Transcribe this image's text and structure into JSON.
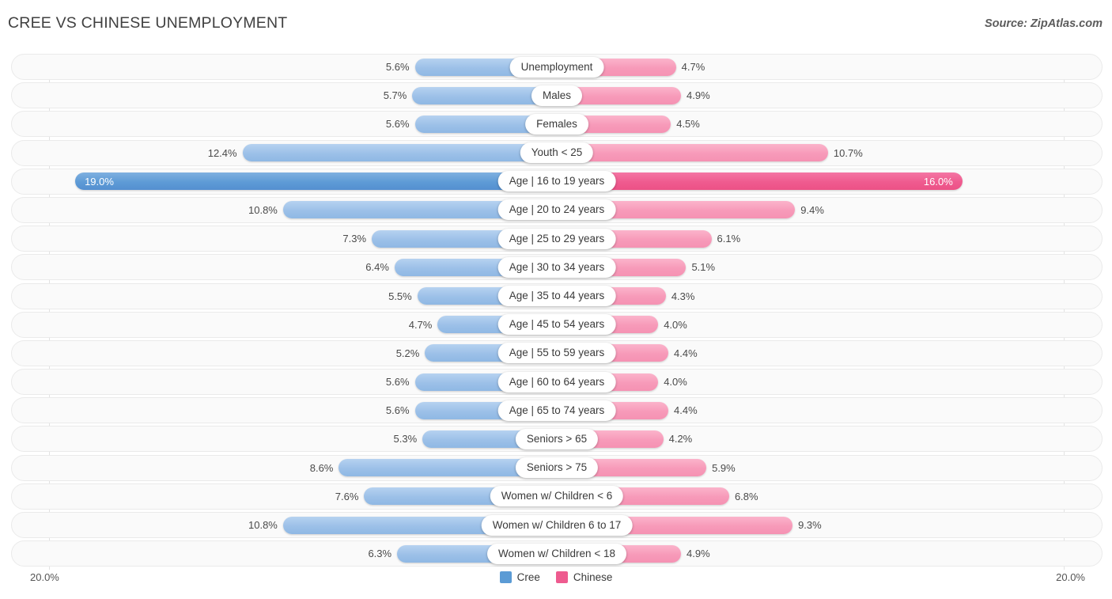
{
  "header": {
    "title": "CREE VS CHINESE UNEMPLOYMENT",
    "source": "Source: ZipAtlas.com"
  },
  "axis": {
    "left_max_label": "20.0%",
    "right_max_label": "20.0%",
    "max_value": 20.0
  },
  "legend": {
    "items": [
      {
        "label": "Cree",
        "color": "#5b9bd5",
        "icon": "square-swatch"
      },
      {
        "label": "Chinese",
        "color": "#ee5b8f",
        "icon": "square-swatch"
      }
    ]
  },
  "chart_data": {
    "type": "bar",
    "subtype": "diverging-butterfly",
    "title": "CREE VS CHINESE UNEMPLOYMENT",
    "xlabel": "",
    "ylabel": "",
    "xlim": [
      0,
      20
    ],
    "grid": false,
    "legend_position": "bottom-center",
    "units": "percent",
    "categories": [
      "Unemployment",
      "Males",
      "Females",
      "Youth < 25",
      "Age | 16 to 19 years",
      "Age | 20 to 24 years",
      "Age | 25 to 29 years",
      "Age | 30 to 34 years",
      "Age | 35 to 44 years",
      "Age | 45 to 54 years",
      "Age | 55 to 59 years",
      "Age | 60 to 64 years",
      "Age | 65 to 74 years",
      "Seniors > 65",
      "Seniors > 75",
      "Women w/ Children < 6",
      "Women w/ Children 6 to 17",
      "Women w/ Children < 18"
    ],
    "series": [
      {
        "name": "Cree",
        "color": "#5b9bd5",
        "side": "left",
        "values": [
          5.6,
          5.7,
          5.6,
          12.4,
          19.0,
          10.8,
          7.3,
          6.4,
          5.5,
          4.7,
          5.2,
          5.6,
          5.6,
          5.3,
          8.6,
          7.6,
          10.8,
          6.3
        ],
        "labels": [
          "5.6%",
          "5.7%",
          "5.6%",
          "12.4%",
          "19.0%",
          "10.8%",
          "7.3%",
          "6.4%",
          "5.5%",
          "4.7%",
          "5.2%",
          "5.6%",
          "5.6%",
          "5.3%",
          "8.6%",
          "7.6%",
          "10.8%",
          "6.3%"
        ]
      },
      {
        "name": "Chinese",
        "color": "#ee5b8f",
        "side": "right",
        "values": [
          4.7,
          4.9,
          4.5,
          10.7,
          16.0,
          9.4,
          6.1,
          5.1,
          4.3,
          4.0,
          4.4,
          4.0,
          4.4,
          4.2,
          5.9,
          6.8,
          9.3,
          4.9
        ],
        "labels": [
          "4.7%",
          "4.9%",
          "4.5%",
          "10.7%",
          "16.0%",
          "9.4%",
          "6.1%",
          "5.1%",
          "4.3%",
          "4.0%",
          "4.4%",
          "4.0%",
          "4.4%",
          "4.2%",
          "5.9%",
          "6.8%",
          "9.3%",
          "4.9%"
        ]
      }
    ],
    "highlighted_rows": [
      "Age | 16 to 19 years"
    ]
  },
  "rows": [
    {
      "label": "Unemployment",
      "left": 5.6,
      "left_label": "5.6%",
      "right": 4.7,
      "right_label": "4.7%",
      "max": false
    },
    {
      "label": "Males",
      "left": 5.7,
      "left_label": "5.7%",
      "right": 4.9,
      "right_label": "4.9%",
      "max": false
    },
    {
      "label": "Females",
      "left": 5.6,
      "left_label": "5.6%",
      "right": 4.5,
      "right_label": "4.5%",
      "max": false
    },
    {
      "label": "Youth < 25",
      "left": 12.4,
      "left_label": "12.4%",
      "right": 10.7,
      "right_label": "10.7%",
      "max": false
    },
    {
      "label": "Age | 16 to 19 years",
      "left": 19.0,
      "left_label": "19.0%",
      "right": 16.0,
      "right_label": "16.0%",
      "max": true
    },
    {
      "label": "Age | 20 to 24 years",
      "left": 10.8,
      "left_label": "10.8%",
      "right": 9.4,
      "right_label": "9.4%",
      "max": false
    },
    {
      "label": "Age | 25 to 29 years",
      "left": 7.3,
      "left_label": "7.3%",
      "right": 6.1,
      "right_label": "6.1%",
      "max": false
    },
    {
      "label": "Age | 30 to 34 years",
      "left": 6.4,
      "left_label": "6.4%",
      "right": 5.1,
      "right_label": "5.1%",
      "max": false
    },
    {
      "label": "Age | 35 to 44 years",
      "left": 5.5,
      "left_label": "5.5%",
      "right": 4.3,
      "right_label": "4.3%",
      "max": false
    },
    {
      "label": "Age | 45 to 54 years",
      "left": 4.7,
      "left_label": "4.7%",
      "right": 4.0,
      "right_label": "4.0%",
      "max": false
    },
    {
      "label": "Age | 55 to 59 years",
      "left": 5.2,
      "left_label": "5.2%",
      "right": 4.4,
      "right_label": "4.4%",
      "max": false
    },
    {
      "label": "Age | 60 to 64 years",
      "left": 5.6,
      "left_label": "5.6%",
      "right": 4.0,
      "right_label": "4.0%",
      "max": false
    },
    {
      "label": "Age | 65 to 74 years",
      "left": 5.6,
      "left_label": "5.6%",
      "right": 4.4,
      "right_label": "4.4%",
      "max": false
    },
    {
      "label": "Seniors > 65",
      "left": 5.3,
      "left_label": "5.3%",
      "right": 4.2,
      "right_label": "4.2%",
      "max": false
    },
    {
      "label": "Seniors > 75",
      "left": 8.6,
      "left_label": "8.6%",
      "right": 5.9,
      "right_label": "5.9%",
      "max": false
    },
    {
      "label": "Women w/ Children < 6",
      "left": 7.6,
      "left_label": "7.6%",
      "right": 6.8,
      "right_label": "6.8%",
      "max": false
    },
    {
      "label": "Women w/ Children 6 to 17",
      "left": 10.8,
      "left_label": "10.8%",
      "right": 9.3,
      "right_label": "9.3%",
      "max": false
    },
    {
      "label": "Women w/ Children < 18",
      "left": 6.3,
      "left_label": "6.3%",
      "right": 4.9,
      "right_label": "4.9%",
      "max": false
    }
  ]
}
